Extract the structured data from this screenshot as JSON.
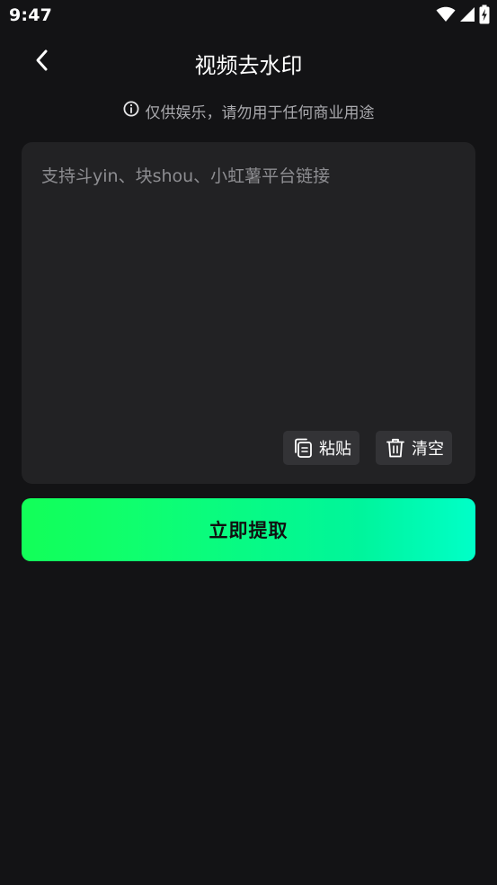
{
  "status_bar": {
    "time": "9:47",
    "icons": [
      "wifi-icon",
      "cellular-signal-icon",
      "battery-charging-icon"
    ]
  },
  "header": {
    "back_icon": "chevron-left-icon",
    "title": "视频去水印"
  },
  "notice": {
    "icon": "info-circle-icon",
    "text": "仅供娱乐，请勿用于任何商业用途"
  },
  "input": {
    "placeholder": "支持斗yin、块shou、小虹薯平台链接",
    "value": ""
  },
  "actions": {
    "paste": {
      "label": "粘贴",
      "icon": "paste-icon"
    },
    "clear": {
      "label": "清空",
      "icon": "trash-icon"
    }
  },
  "submit": {
    "label": "立即提取"
  },
  "colors": {
    "background": "#131315",
    "card": "#222224",
    "action_button": "#333336",
    "gradient_start": "#12ff58",
    "gradient_end": "#00ffc8",
    "muted_text": "#a9a9ad"
  }
}
